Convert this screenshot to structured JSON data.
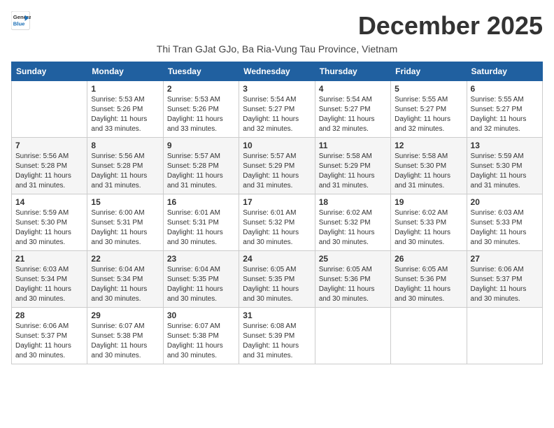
{
  "logo": {
    "line1": "General",
    "line2": "Blue"
  },
  "title": "December 2025",
  "subtitle": "Thi Tran GJat GJo, Ba Ria-Vung Tau Province, Vietnam",
  "days_of_week": [
    "Sunday",
    "Monday",
    "Tuesday",
    "Wednesday",
    "Thursday",
    "Friday",
    "Saturday"
  ],
  "weeks": [
    [
      {
        "day": "",
        "sunrise": "",
        "sunset": "",
        "daylight": ""
      },
      {
        "day": "1",
        "sunrise": "Sunrise: 5:53 AM",
        "sunset": "Sunset: 5:26 PM",
        "daylight": "Daylight: 11 hours and 33 minutes."
      },
      {
        "day": "2",
        "sunrise": "Sunrise: 5:53 AM",
        "sunset": "Sunset: 5:26 PM",
        "daylight": "Daylight: 11 hours and 33 minutes."
      },
      {
        "day": "3",
        "sunrise": "Sunrise: 5:54 AM",
        "sunset": "Sunset: 5:27 PM",
        "daylight": "Daylight: 11 hours and 32 minutes."
      },
      {
        "day": "4",
        "sunrise": "Sunrise: 5:54 AM",
        "sunset": "Sunset: 5:27 PM",
        "daylight": "Daylight: 11 hours and 32 minutes."
      },
      {
        "day": "5",
        "sunrise": "Sunrise: 5:55 AM",
        "sunset": "Sunset: 5:27 PM",
        "daylight": "Daylight: 11 hours and 32 minutes."
      },
      {
        "day": "6",
        "sunrise": "Sunrise: 5:55 AM",
        "sunset": "Sunset: 5:27 PM",
        "daylight": "Daylight: 11 hours and 32 minutes."
      }
    ],
    [
      {
        "day": "7",
        "sunrise": "Sunrise: 5:56 AM",
        "sunset": "Sunset: 5:28 PM",
        "daylight": "Daylight: 11 hours and 31 minutes."
      },
      {
        "day": "8",
        "sunrise": "Sunrise: 5:56 AM",
        "sunset": "Sunset: 5:28 PM",
        "daylight": "Daylight: 11 hours and 31 minutes."
      },
      {
        "day": "9",
        "sunrise": "Sunrise: 5:57 AM",
        "sunset": "Sunset: 5:28 PM",
        "daylight": "Daylight: 11 hours and 31 minutes."
      },
      {
        "day": "10",
        "sunrise": "Sunrise: 5:57 AM",
        "sunset": "Sunset: 5:29 PM",
        "daylight": "Daylight: 11 hours and 31 minutes."
      },
      {
        "day": "11",
        "sunrise": "Sunrise: 5:58 AM",
        "sunset": "Sunset: 5:29 PM",
        "daylight": "Daylight: 11 hours and 31 minutes."
      },
      {
        "day": "12",
        "sunrise": "Sunrise: 5:58 AM",
        "sunset": "Sunset: 5:30 PM",
        "daylight": "Daylight: 11 hours and 31 minutes."
      },
      {
        "day": "13",
        "sunrise": "Sunrise: 5:59 AM",
        "sunset": "Sunset: 5:30 PM",
        "daylight": "Daylight: 11 hours and 31 minutes."
      }
    ],
    [
      {
        "day": "14",
        "sunrise": "Sunrise: 5:59 AM",
        "sunset": "Sunset: 5:30 PM",
        "daylight": "Daylight: 11 hours and 30 minutes."
      },
      {
        "day": "15",
        "sunrise": "Sunrise: 6:00 AM",
        "sunset": "Sunset: 5:31 PM",
        "daylight": "Daylight: 11 hours and 30 minutes."
      },
      {
        "day": "16",
        "sunrise": "Sunrise: 6:01 AM",
        "sunset": "Sunset: 5:31 PM",
        "daylight": "Daylight: 11 hours and 30 minutes."
      },
      {
        "day": "17",
        "sunrise": "Sunrise: 6:01 AM",
        "sunset": "Sunset: 5:32 PM",
        "daylight": "Daylight: 11 hours and 30 minutes."
      },
      {
        "day": "18",
        "sunrise": "Sunrise: 6:02 AM",
        "sunset": "Sunset: 5:32 PM",
        "daylight": "Daylight: 11 hours and 30 minutes."
      },
      {
        "day": "19",
        "sunrise": "Sunrise: 6:02 AM",
        "sunset": "Sunset: 5:33 PM",
        "daylight": "Daylight: 11 hours and 30 minutes."
      },
      {
        "day": "20",
        "sunrise": "Sunrise: 6:03 AM",
        "sunset": "Sunset: 5:33 PM",
        "daylight": "Daylight: 11 hours and 30 minutes."
      }
    ],
    [
      {
        "day": "21",
        "sunrise": "Sunrise: 6:03 AM",
        "sunset": "Sunset: 5:34 PM",
        "daylight": "Daylight: 11 hours and 30 minutes."
      },
      {
        "day": "22",
        "sunrise": "Sunrise: 6:04 AM",
        "sunset": "Sunset: 5:34 PM",
        "daylight": "Daylight: 11 hours and 30 minutes."
      },
      {
        "day": "23",
        "sunrise": "Sunrise: 6:04 AM",
        "sunset": "Sunset: 5:35 PM",
        "daylight": "Daylight: 11 hours and 30 minutes."
      },
      {
        "day": "24",
        "sunrise": "Sunrise: 6:05 AM",
        "sunset": "Sunset: 5:35 PM",
        "daylight": "Daylight: 11 hours and 30 minutes."
      },
      {
        "day": "25",
        "sunrise": "Sunrise: 6:05 AM",
        "sunset": "Sunset: 5:36 PM",
        "daylight": "Daylight: 11 hours and 30 minutes."
      },
      {
        "day": "26",
        "sunrise": "Sunrise: 6:05 AM",
        "sunset": "Sunset: 5:36 PM",
        "daylight": "Daylight: 11 hours and 30 minutes."
      },
      {
        "day": "27",
        "sunrise": "Sunrise: 6:06 AM",
        "sunset": "Sunset: 5:37 PM",
        "daylight": "Daylight: 11 hours and 30 minutes."
      }
    ],
    [
      {
        "day": "28",
        "sunrise": "Sunrise: 6:06 AM",
        "sunset": "Sunset: 5:37 PM",
        "daylight": "Daylight: 11 hours and 30 minutes."
      },
      {
        "day": "29",
        "sunrise": "Sunrise: 6:07 AM",
        "sunset": "Sunset: 5:38 PM",
        "daylight": "Daylight: 11 hours and 30 minutes."
      },
      {
        "day": "30",
        "sunrise": "Sunrise: 6:07 AM",
        "sunset": "Sunset: 5:38 PM",
        "daylight": "Daylight: 11 hours and 30 minutes."
      },
      {
        "day": "31",
        "sunrise": "Sunrise: 6:08 AM",
        "sunset": "Sunset: 5:39 PM",
        "daylight": "Daylight: 11 hours and 31 minutes."
      },
      {
        "day": "",
        "sunrise": "",
        "sunset": "",
        "daylight": ""
      },
      {
        "day": "",
        "sunrise": "",
        "sunset": "",
        "daylight": ""
      },
      {
        "day": "",
        "sunrise": "",
        "sunset": "",
        "daylight": ""
      }
    ]
  ]
}
